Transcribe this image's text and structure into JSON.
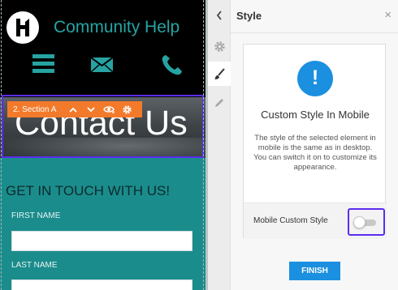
{
  "preview": {
    "site_title": "Community Help",
    "hero_title": "Contact Us",
    "section_toolbar": {
      "label": "2. Section A",
      "actions": [
        "chevron-up-icon",
        "chevron-down-icon",
        "eye-hidden-icon",
        "gear-icon"
      ]
    },
    "nav_icons": [
      "menu-icon",
      "envelope-icon",
      "phone-icon"
    ],
    "contact_heading": "GET IN TOUCH WITH US!",
    "fields": [
      {
        "label": "FIRST NAME",
        "value": ""
      },
      {
        "label": "LAST NAME",
        "value": ""
      }
    ]
  },
  "panel": {
    "title": "Style",
    "close_label": "×",
    "rail_icons": [
      "chevron-left-icon",
      "gear-icon",
      "brush-icon",
      "pencil-icon"
    ],
    "active_rail": "brush-icon",
    "card": {
      "icon_glyph": "!",
      "title": "Custom Style In Mobile",
      "description": "The style of the selected element in mobile is the same as in desktop.\nYou can switch it on to customize its appearance.",
      "row_label": "Mobile Custom Style",
      "toggle_on": false
    },
    "finish_label": "FINISH"
  },
  "colors": {
    "brand_teal": "#27a3a3",
    "accent_blue": "#1b8fe0",
    "toolbar_orange": "#f47a2b",
    "highlight_purple": "#5b2df0"
  }
}
